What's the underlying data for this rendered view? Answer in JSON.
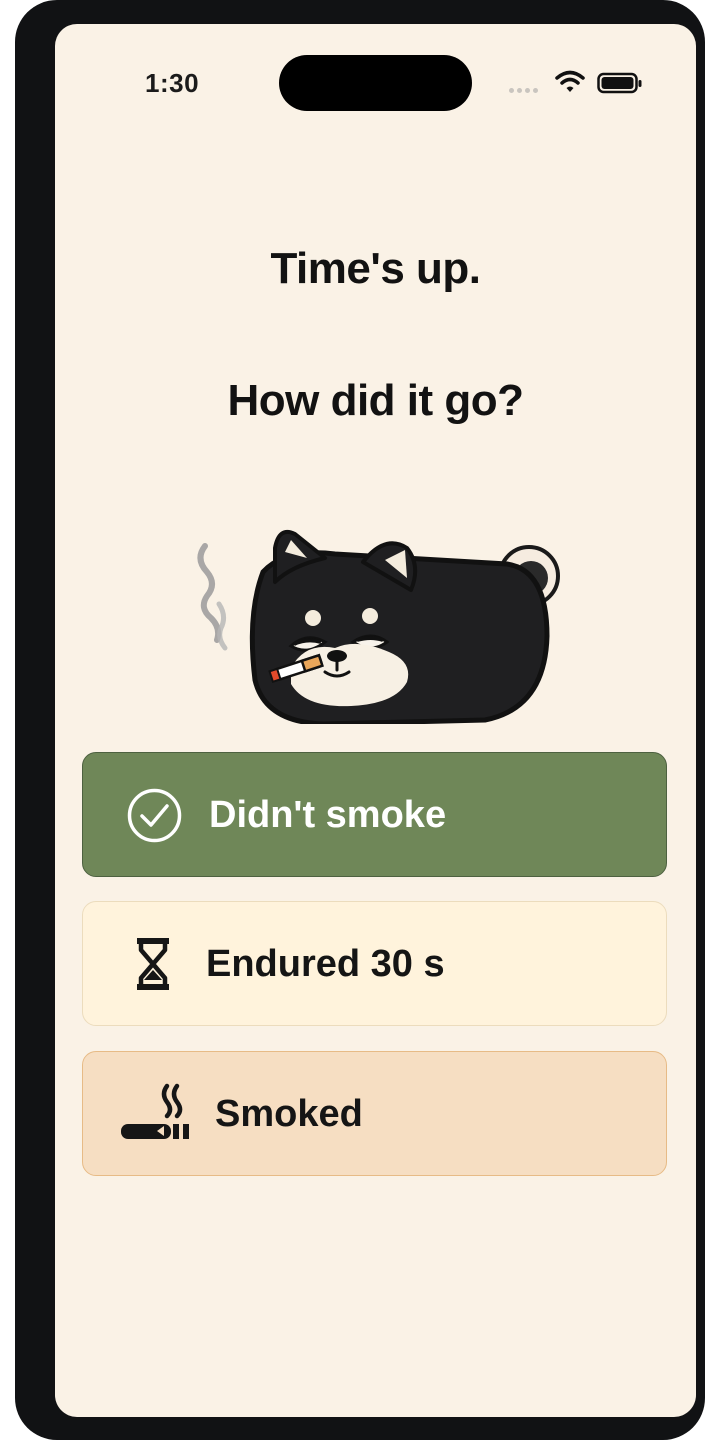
{
  "status_bar": {
    "time": "1:30",
    "icons": [
      "signal-dots-icon",
      "wifi-icon",
      "battery-icon"
    ]
  },
  "heading": {
    "line1": "Time's up.",
    "line2": "How did it go?"
  },
  "mascot": {
    "icon": "smoking-shiba-dog-illustration"
  },
  "options": [
    {
      "label": "Didn't smoke",
      "icon": "check-circle-icon",
      "color": "#6f8758"
    },
    {
      "label": "Endured 30 s",
      "icon": "hourglass-icon",
      "color": "#fff3dc"
    },
    {
      "label": "Smoked",
      "icon": "cigarette-icon",
      "color": "#f6dec2"
    }
  ],
  "colors": {
    "background": "#faf2e6",
    "frame": "#111214",
    "text": "#121212"
  }
}
